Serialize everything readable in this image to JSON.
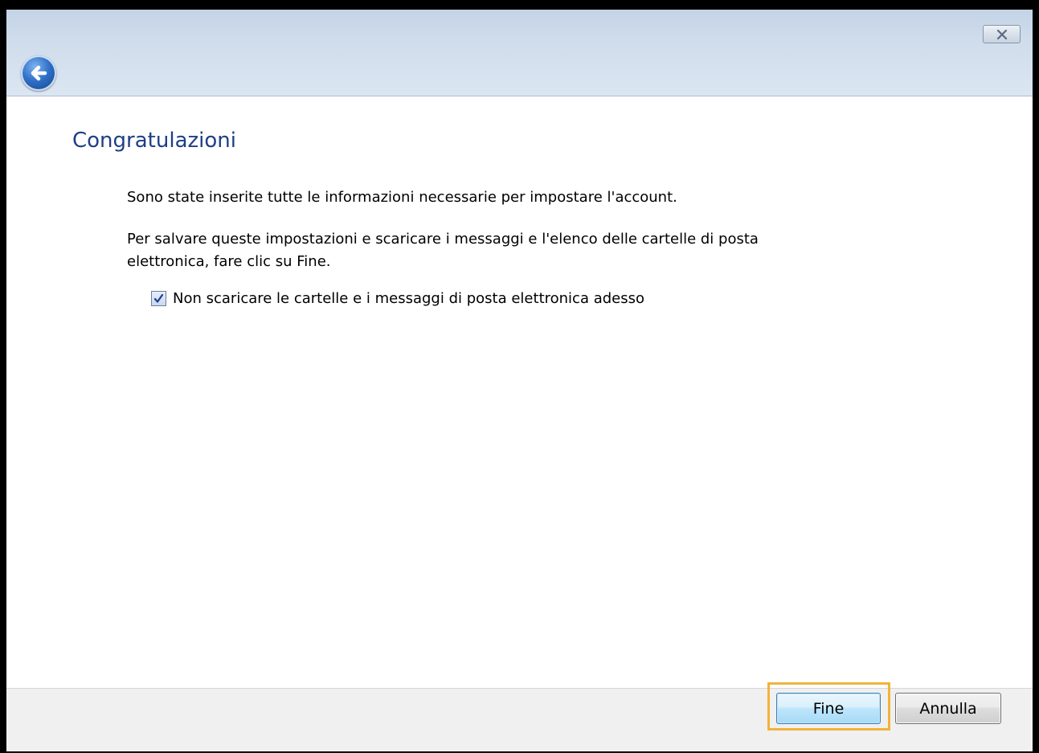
{
  "dialog": {
    "heading": "Congratulazioni",
    "paragraph1": "Sono state inserite tutte le informazioni necessarie per impostare l'account.",
    "paragraph2": "Per salvare queste impostazioni e scaricare i messaggi e l'elenco delle cartelle di posta elettronica, fare clic su Fine.",
    "checkbox": {
      "label": "Non scaricare le cartelle e i messaggi di posta elettronica adesso",
      "checked": true
    }
  },
  "titlebar": {
    "back_icon": "back-arrow-icon",
    "close_icon": "close-icon"
  },
  "footer": {
    "finish_label": "Fine",
    "cancel_label": "Annulla"
  },
  "colors": {
    "heading": "#1e3f86",
    "focus_ring": "#f0b43a",
    "titlebar": "#cfdceb"
  }
}
